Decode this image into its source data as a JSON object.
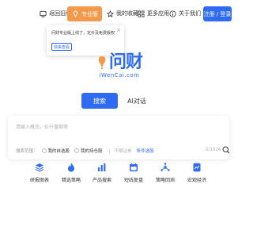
{
  "nav": {
    "old_version": "返回旧版",
    "pro_version": "专业版",
    "my_favorites": "我的收藏",
    "more_apps": "更多应用",
    "about_us": "关于我们",
    "login": "注册 / 登录"
  },
  "popup": {
    "text": "问财专业版上线了，定价及免费版权限。",
    "close": "×",
    "button": "快来查看"
  },
  "logo": {
    "cn": "问财",
    "en": "iWenCai.com"
  },
  "modes": {
    "search": "搜索",
    "ai": "AI对话"
  },
  "search": {
    "placeholder": "请输入概念，价升量缩等",
    "scope_label": "搜索范围：",
    "option_watchlist": "我的自选股",
    "option_holdings": "我的持仓股",
    "stock_filter": "不限证券",
    "condition_filter": "条件选股",
    "char_count": "0/1024"
  },
  "features": [
    {
      "label": "研报图表",
      "icon": "layers-icon"
    },
    {
      "label": "精选策略",
      "icon": "flame-icon"
    },
    {
      "label": "产品搜索",
      "icon": "bar-chart-icon"
    },
    {
      "label": "短线复盘",
      "icon": "calendar-icon"
    },
    {
      "label": "策略回测",
      "icon": "network-icon"
    },
    {
      "label": "宏观经济",
      "icon": "chart-doc-icon"
    }
  ],
  "colors": {
    "brand_blue": "#2f6bf2",
    "pro_orange": "#f29a4a"
  }
}
